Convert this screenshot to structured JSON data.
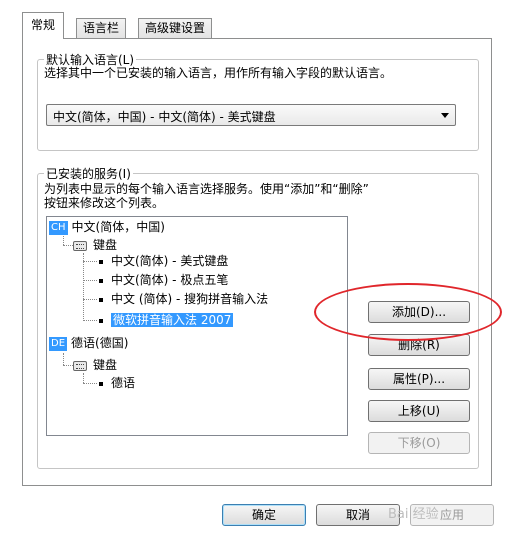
{
  "tabs": [
    "常规",
    "语言栏",
    "高级键设置"
  ],
  "default_language": {
    "title": "默认输入语言(L)",
    "description": "选择其中一个已安装的输入语言，用作所有输入字段的默认语言。",
    "selected": "中文(简体，中国) - 中文(简体) - 美式键盘"
  },
  "installed_services": {
    "title": "已安装的服务(I)",
    "description_line1": "为列表中显示的每个输入语言选择服务。使用“添加”和“删除”",
    "description_line2": "按钮来修改这个列表。",
    "tree": {
      "lang1": {
        "code": "CH",
        "name": "中文(简体，中国)"
      },
      "keyboard_label": "键盘",
      "lang1_items": [
        "中文(简体) - 美式键盘",
        "中文(简体) - 极点五笔",
        "中文 (简体) - 搜狗拼音输入法",
        "微软拼音输入法 2007"
      ],
      "lang2": {
        "code": "DE",
        "name": "德语(德国)"
      },
      "lang2_items": [
        "德语"
      ]
    },
    "buttons": {
      "add": "添加(D)...",
      "remove": "删除(R)",
      "properties": "属性(P)...",
      "move_up": "上移(U)",
      "move_down": "下移(O)"
    }
  },
  "footer": {
    "ok": "确定",
    "cancel": "取消",
    "apply": "应用"
  },
  "watermark": "Bai 经验",
  "colors": {
    "selection": "#3399ff",
    "highlight_ring": "#e0262b"
  }
}
